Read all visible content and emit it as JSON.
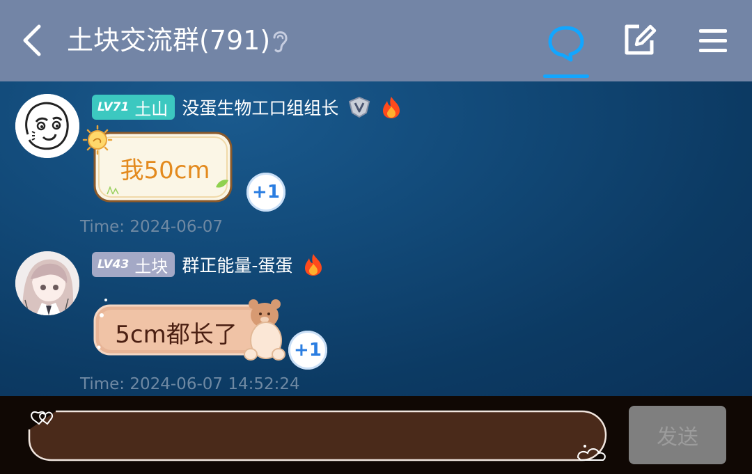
{
  "header": {
    "back_icon": "chevron-left-icon",
    "title": "土块交流群(791)",
    "ear_icon": "ear-icon",
    "chat_icon": "chat-bubble-icon",
    "edit_icon": "edit-icon",
    "menu_icon": "hamburger-menu-icon",
    "accent_color": "#12a6ff",
    "bg_color": "#7385a6"
  },
  "messages": [
    {
      "level": "LV71",
      "title_name": "土山",
      "nickname": "没蛋生物工口组组长",
      "badges": [
        "v-shield-icon",
        "fire-icon"
      ],
      "text": "我50cm",
      "plus": "+1",
      "time": "Time: 2024-06-07"
    },
    {
      "level": "LV43",
      "title_name": "土块",
      "nickname": "群正能量-蛋蛋",
      "badges": [
        "fire-icon"
      ],
      "text": "5cm都长了",
      "plus": "+1",
      "time": "Time: 2024-06-07 14:52:24"
    }
  ],
  "input": {
    "placeholder": "",
    "send_label": "发送"
  }
}
